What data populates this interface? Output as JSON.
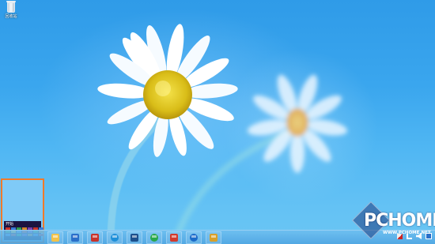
{
  "desktop": {
    "icons": [
      {
        "label": "回收站",
        "icon": "recycle-bin-icon"
      }
    ]
  },
  "start_preview": {
    "title": "开始",
    "tile_colors": [
      "#c8322a",
      "#3a7bd5",
      "#2e9b4f",
      "#d4862a",
      "#7a3fb0",
      "#c8322a",
      "#3a7bd5",
      "#2e9b4f",
      "#e0c030",
      "#3a7bd5",
      "#c8322a",
      "#7a3fb0",
      "#2e9b4f",
      "#d4862a",
      "#3a7bd5",
      "#c8322a",
      "#2e9b4f",
      "#7a3fb0",
      "#d4862a",
      "#3a7bd5",
      "#c8322a"
    ]
  },
  "taskbar": {
    "items": [
      {
        "name": "taskbar-explorer",
        "icon": "folder-icon",
        "color": "#f2c24a"
      },
      {
        "name": "taskbar-outlook",
        "icon": "outlook-icon",
        "color": "#2a6fc9"
      },
      {
        "name": "taskbar-autocad",
        "icon": "autocad-icon",
        "color": "#c8322a"
      },
      {
        "name": "taskbar-sogou",
        "icon": "sogou-icon",
        "color": "#1f8fd8"
      },
      {
        "name": "taskbar-photoshop",
        "icon": "photoshop-icon",
        "color": "#1c4f8c"
      },
      {
        "name": "taskbar-360-browser",
        "icon": "360-browser-icon",
        "color": "#29a84a"
      },
      {
        "name": "taskbar-xmind",
        "icon": "xmind-icon",
        "color": "#d23a2e"
      },
      {
        "name": "taskbar-maxthon",
        "icon": "maxthon-icon",
        "color": "#1c6bc9"
      },
      {
        "name": "taskbar-app",
        "icon": "app-icon",
        "color": "#d8a02a"
      }
    ],
    "tray_icons": [
      "flag-icon",
      "network-icon",
      "volume-icon",
      "input-method-icon"
    ]
  },
  "watermark": {
    "logo": "PCHOME",
    "url": "WWW.PCHOME.NET"
  }
}
